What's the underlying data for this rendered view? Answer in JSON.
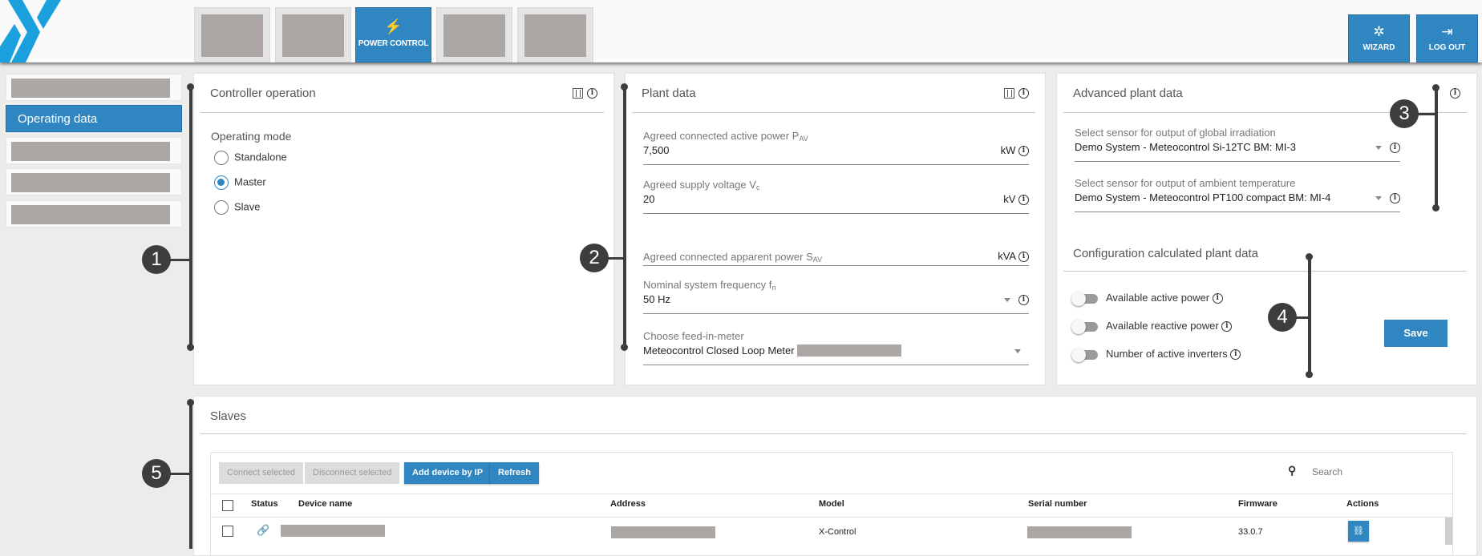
{
  "header": {
    "nav_tabs": [
      {
        "label": "",
        "redacted": true
      },
      {
        "label": "",
        "redacted": true
      },
      {
        "label": "POWER CONTROL",
        "icon": "transmission-tower-icon",
        "active": true
      },
      {
        "label": "",
        "redacted": true
      },
      {
        "label": "",
        "redacted": true
      }
    ],
    "wizard_label": "WIZARD",
    "logout_label": "LOG OUT",
    "brand_color": "#2f86c1"
  },
  "sidebar": {
    "items": [
      {
        "label": "",
        "redacted": true
      },
      {
        "label": "Operating data",
        "active": true
      },
      {
        "label": "",
        "redacted": true
      },
      {
        "label": "",
        "redacted": true
      },
      {
        "label": "",
        "redacted": true
      }
    ]
  },
  "controller": {
    "title": "Controller operation",
    "mode_label": "Operating mode",
    "options": [
      "Standalone",
      "Master",
      "Slave"
    ],
    "selected": "Master"
  },
  "plant": {
    "title": "Plant data",
    "active_power": {
      "label": "Agreed connected active power P",
      "sub": "AV",
      "value": "7,500",
      "unit": "kW"
    },
    "supply_voltage": {
      "label": "Agreed supply voltage V",
      "sub": "c",
      "value": "20",
      "unit": "kV"
    },
    "apparent_power": {
      "label": "Agreed connected apparent power S",
      "sub": "AV",
      "value": "",
      "unit": "kVA"
    },
    "frequency": {
      "label": "Nominal system frequency f",
      "sub": "n",
      "value": "50 Hz"
    },
    "meter": {
      "label": "Choose feed-in-meter",
      "value": "Meteocontrol Closed Loop Meter"
    }
  },
  "advanced": {
    "title": "Advanced plant data",
    "irradiation": {
      "label": "Select sensor for output of global irradiation",
      "value": "Demo System - Meteocontrol Si-12TC BM: MI-3"
    },
    "temperature": {
      "label": "Select sensor for output of ambient temperature",
      "value": "Demo System - Meteocontrol PT100 compact BM: MI-4"
    }
  },
  "calculated": {
    "title": "Configuration calculated plant data",
    "toggles": [
      {
        "label": "Available active power",
        "on": false
      },
      {
        "label": "Available reactive power",
        "on": false
      },
      {
        "label": "Number of active inverters",
        "on": false
      }
    ],
    "save_label": "Save"
  },
  "slaves": {
    "title": "Slaves",
    "buttons": {
      "connect": "Connect selected",
      "disconnect": "Disconnect selected",
      "add": "Add device by IP",
      "refresh": "Refresh"
    },
    "search_placeholder": "Search",
    "columns": [
      "Status",
      "Device name",
      "Address",
      "Model",
      "Serial number",
      "Firmware",
      "Actions"
    ],
    "rows": [
      {
        "status": "link-icon",
        "device_name": "",
        "address": "",
        "model": "X-Control",
        "serial": "",
        "firmware": "33.0.7"
      }
    ]
  },
  "annotations": [
    "1",
    "2",
    "3",
    "4",
    "5"
  ]
}
